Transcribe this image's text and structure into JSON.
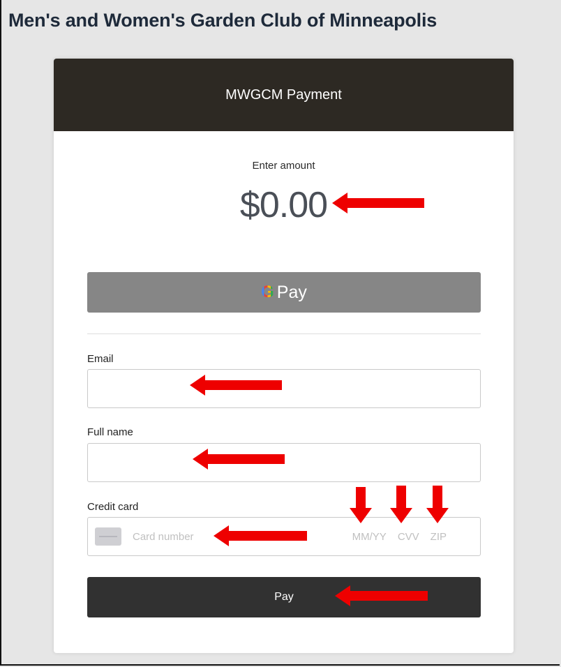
{
  "site": {
    "title": "Men's and Women's Garden Club of Minneapolis"
  },
  "payment": {
    "header": "MWGCM Payment",
    "enter_amount_label": "Enter amount",
    "amount": "$0.00",
    "gpay_label": "Pay",
    "email_label": "Email",
    "full_name_label": "Full name",
    "credit_card_label": "Credit card",
    "card_number_placeholder": "Card number",
    "expiry_placeholder": "MM/YY",
    "cvv_placeholder": "CVV",
    "zip_placeholder": "ZIP",
    "pay_button": "Pay"
  },
  "colors": {
    "header_bg": "#2d2923",
    "gpay_bg": "#868686",
    "pay_button_bg": "#313131",
    "annotation_arrow": "#ee0000"
  }
}
